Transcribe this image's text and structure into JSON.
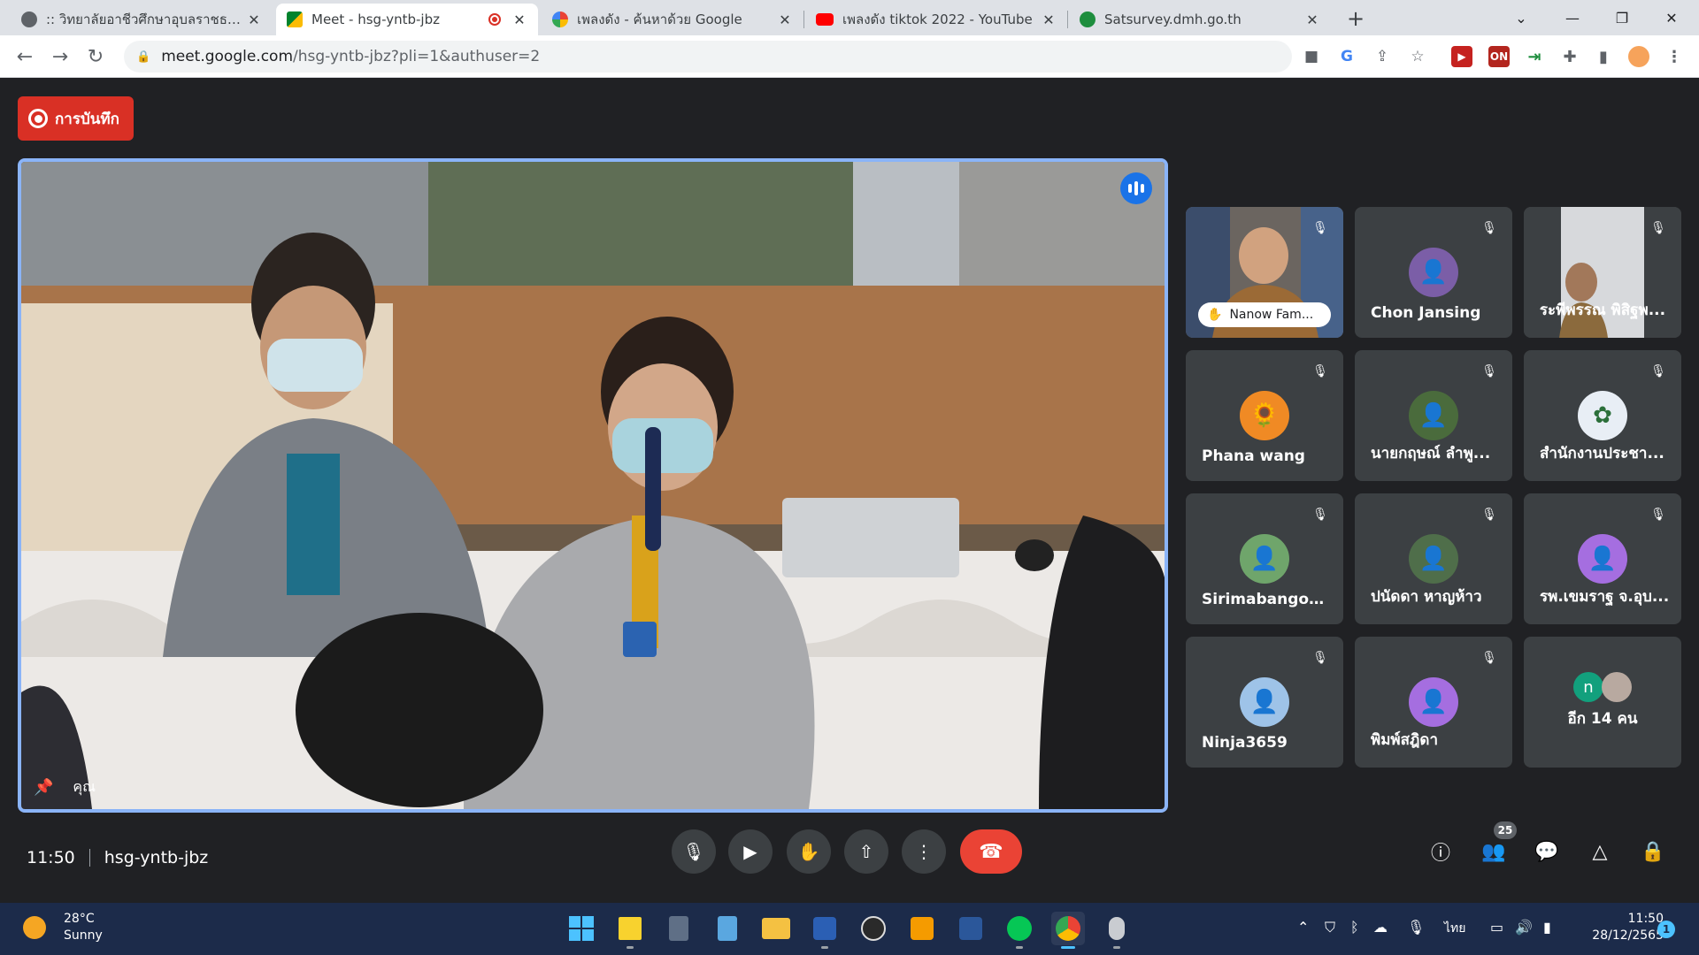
{
  "browser": {
    "tabs": [
      {
        "title": ":: วิทยาลัยอาชีวศึกษาอุบลราชธานี ::",
        "icon": "globe-icon",
        "active": false
      },
      {
        "title": "Meet - hsg-yntb-jbz",
        "icon": "meet-icon",
        "active": true
      },
      {
        "title": "เพลงดัง - ค้นหาด้วย Google",
        "icon": "google-icon",
        "active": false
      },
      {
        "title": "เพลงดัง tiktok 2022 - YouTube",
        "icon": "youtube-icon",
        "active": false
      },
      {
        "title": "Satsurvey.dmh.go.th",
        "icon": "shield-icon",
        "active": false
      }
    ],
    "url_host": "meet.google.com",
    "url_path": "/hsg-yntb-jbz?pli=1&authuser=2"
  },
  "meet": {
    "record_label": "การบันทึก",
    "main_speaker_name": "คุณ",
    "meeting_time": "11:50",
    "meeting_code": "hsg-yntb-jbz",
    "participant_count": "25",
    "participants": [
      {
        "name": "Nanow Fam...",
        "type": "video",
        "hand_raised": true
      },
      {
        "name": "Chon Jansing",
        "type": "avatar",
        "color": "#7b5ea7"
      },
      {
        "name": "ระพีพรรณ พิสิฐพ...",
        "type": "video"
      },
      {
        "name": "Phana wang",
        "type": "avatar",
        "color": "#f08a24"
      },
      {
        "name": "นายกฤษณ์ ลำพู...",
        "type": "avatar",
        "color": "#4a6b3c"
      },
      {
        "name": "สำนักงานประชา...",
        "type": "avatar",
        "color": "#e8eef5"
      },
      {
        "name": "Sirimabangon ...",
        "type": "avatar",
        "color": "#6fa56b"
      },
      {
        "name": "ปนัดดา หาญห้าว",
        "type": "avatar",
        "color": "#4f6e4a"
      },
      {
        "name": "รพ.เขมราฐ จ.อุบ...",
        "type": "avatar",
        "color": "#a56ee0"
      },
      {
        "name": "Ninja3659",
        "type": "avatar",
        "color": "#9ec3e8"
      },
      {
        "name": "พิมพ์สฎิดา",
        "type": "avatar",
        "color": "#a56ee0"
      }
    ],
    "more_label": "อีก 14 คน",
    "more_initial": "n"
  },
  "taskbar": {
    "temperature": "28°C",
    "weather": "Sunny",
    "language": "ไทย",
    "clock_time": "11:50",
    "clock_date": "28/12/2565",
    "notification_count": "1"
  }
}
